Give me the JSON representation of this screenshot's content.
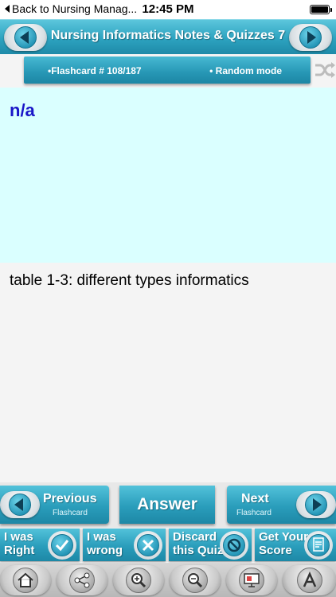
{
  "status_bar": {
    "back_label": "Back to Nursing Manag...",
    "time": "12:45 PM",
    "battery_level": 1.0
  },
  "header": {
    "title": "Nursing Informatics Notes & Quizzes 7",
    "prev_icon": "arrow-left-icon",
    "next_icon": "arrow-right-icon"
  },
  "info_bar": {
    "card_count": "•Flashcard #  108/187",
    "mode": "• Random mode",
    "shuffle_icon": "shuffle-icon"
  },
  "card": {
    "question": "n/a",
    "answer": "table 1-3: different types informatics"
  },
  "nav": {
    "previous_label": "Previous",
    "previous_sub": "Flashcard",
    "answer_label": "Answer",
    "next_label": "Next",
    "next_sub": "Flashcard"
  },
  "actions": [
    {
      "label": "I was\nRight",
      "icon": "checkmark-icon"
    },
    {
      "label": "I was\nwrong",
      "icon": "x-icon"
    },
    {
      "label": "Discard\nthis Quiz",
      "icon": "prohibited-icon"
    },
    {
      "label": "Get Your\nScore",
      "icon": "score-sheet-icon"
    }
  ],
  "tools": [
    "home-icon",
    "share-icon",
    "zoom-in-icon",
    "zoom-out-icon",
    "slideshow-icon",
    "font-size-icon"
  ],
  "colors": {
    "accent": "#2da3c0",
    "question_bg": "#daffff",
    "question_text": "#1a16c8"
  }
}
